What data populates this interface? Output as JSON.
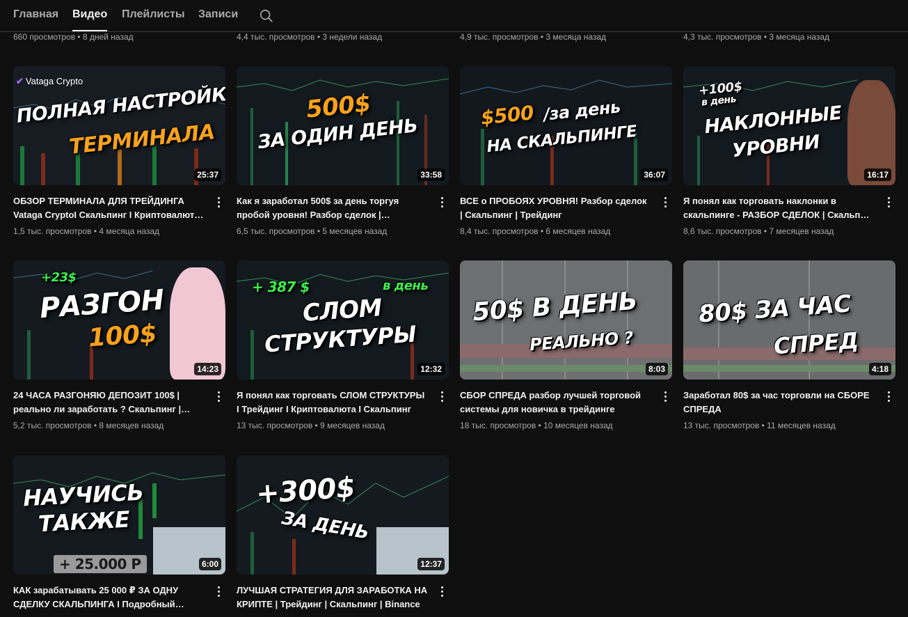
{
  "tabs": [
    {
      "label": "Главная",
      "active": false
    },
    {
      "label": "Видео",
      "active": true
    },
    {
      "label": "Плейлисты",
      "active": false
    },
    {
      "label": "Записи",
      "active": false
    }
  ],
  "search_icon": "search-icon",
  "top_row_meta": [
    "660 просмотров • 8 дней назад",
    "4,4 тыс. просмотров • 3 недели назад",
    "4,9 тыс. просмотров • 3 месяца назад",
    "4,3 тыс. просмотров • 3 месяца назад"
  ],
  "videos": [
    {
      "title": "ОБЗОР ТЕРМИНАЛА ДЛЯ ТРЕЙДИНГА Vataga CryptoI Скальпинг I Криптовалют…",
      "meta": "1,5 тыс. просмотров • 4 месяца назад",
      "duration": "25:37",
      "overlay": [
        "Vataga Crypto",
        "ПОЛНАЯ НАСТРОЙКА",
        "ТЕРМИНАЛА"
      ]
    },
    {
      "title": "Как я заработал 500$ за день торгуя пробой уровня! Разбор сделок |…",
      "meta": "6,5 тыс. просмотров • 5 месяцев назад",
      "duration": "33:58",
      "overlay": [
        "500$",
        "ЗА ОДИН ДЕНЬ"
      ]
    },
    {
      "title": "ВСЕ о ПРОБОЯХ УРОВНЯ! Разбор сделок | Скальпинг | Трейдинг",
      "meta": "8,4 тыс. просмотров • 6 месяцев назад",
      "duration": "36:07",
      "overlay": [
        "$500",
        "/за день",
        "НА СКАЛЬПИНГЕ"
      ]
    },
    {
      "title": "Я понял как торговать наклонки в скальпинге - РАЗБОР СДЕЛОК | Скальп…",
      "meta": "8,6 тыс. просмотров • 7 месяцев назад",
      "duration": "16:17",
      "overlay": [
        "+100$",
        "в день",
        "НАКЛОННЫЕ",
        "УРОВНИ"
      ]
    },
    {
      "title": "24 ЧАСА РАЗГОНЯЮ ДЕПОЗИТ 100$ | реально ли заработать ? Скальпинг |…",
      "meta": "5,2 тыс. просмотров • 8 месяцев назад",
      "duration": "14:23",
      "overlay": [
        "+23$",
        "РАЗГОН",
        "100$"
      ]
    },
    {
      "title": "Я понял как торговать СЛОМ СТРУКТУРЫ I Трейдинг I Криптовалюта I Скальпинг",
      "meta": "13 тыс. просмотров • 9 месяцев назад",
      "duration": "12:32",
      "overlay": [
        "+ 387 $",
        "в день",
        "СЛОМ",
        "СТРУКТУРЫ"
      ]
    },
    {
      "title": "СБОР СПРЕДА разбор лучшей торговой системы для новичка в трейдинге",
      "meta": "18 тыс. просмотров • 10 месяцев назад",
      "duration": "8:03",
      "overlay": [
        "50$ В ДЕНЬ",
        "РЕАЛЬНО ?"
      ]
    },
    {
      "title": "Заработал 80$ за час торговли на СБОРЕ СПРЕДА",
      "meta": "13 тыс. просмотров • 11 месяцев назад",
      "duration": "4:18",
      "overlay": [
        "80$ ЗА ЧАС",
        "СПРЕД"
      ]
    },
    {
      "title": "КАК зарабатывать 25 000 ₽ ЗА ОДНУ СДЕЛКУ СКАЛЬПИНГА I Подробный…",
      "meta": "",
      "duration": "6:00",
      "overlay": [
        "НАУЧИСЬ",
        "ТАКЖЕ",
        "+ 25.000 Р"
      ]
    },
    {
      "title": "ЛУЧШАЯ СТРАТЕГИЯ ДЛЯ ЗАРАБОТКА НА КРИПТЕ | Трейдинг | Скальпинг | Binance",
      "meta": "",
      "duration": "12:37",
      "overlay": [
        "+300$",
        "ЗА ДЕНЬ"
      ]
    }
  ],
  "colors": {
    "background": "#0f0f0f",
    "text": "#f1f1f1",
    "secondary": "#aaaaaa",
    "accent_orange": "#f7a21b",
    "accent_green": "#3ef04a"
  }
}
